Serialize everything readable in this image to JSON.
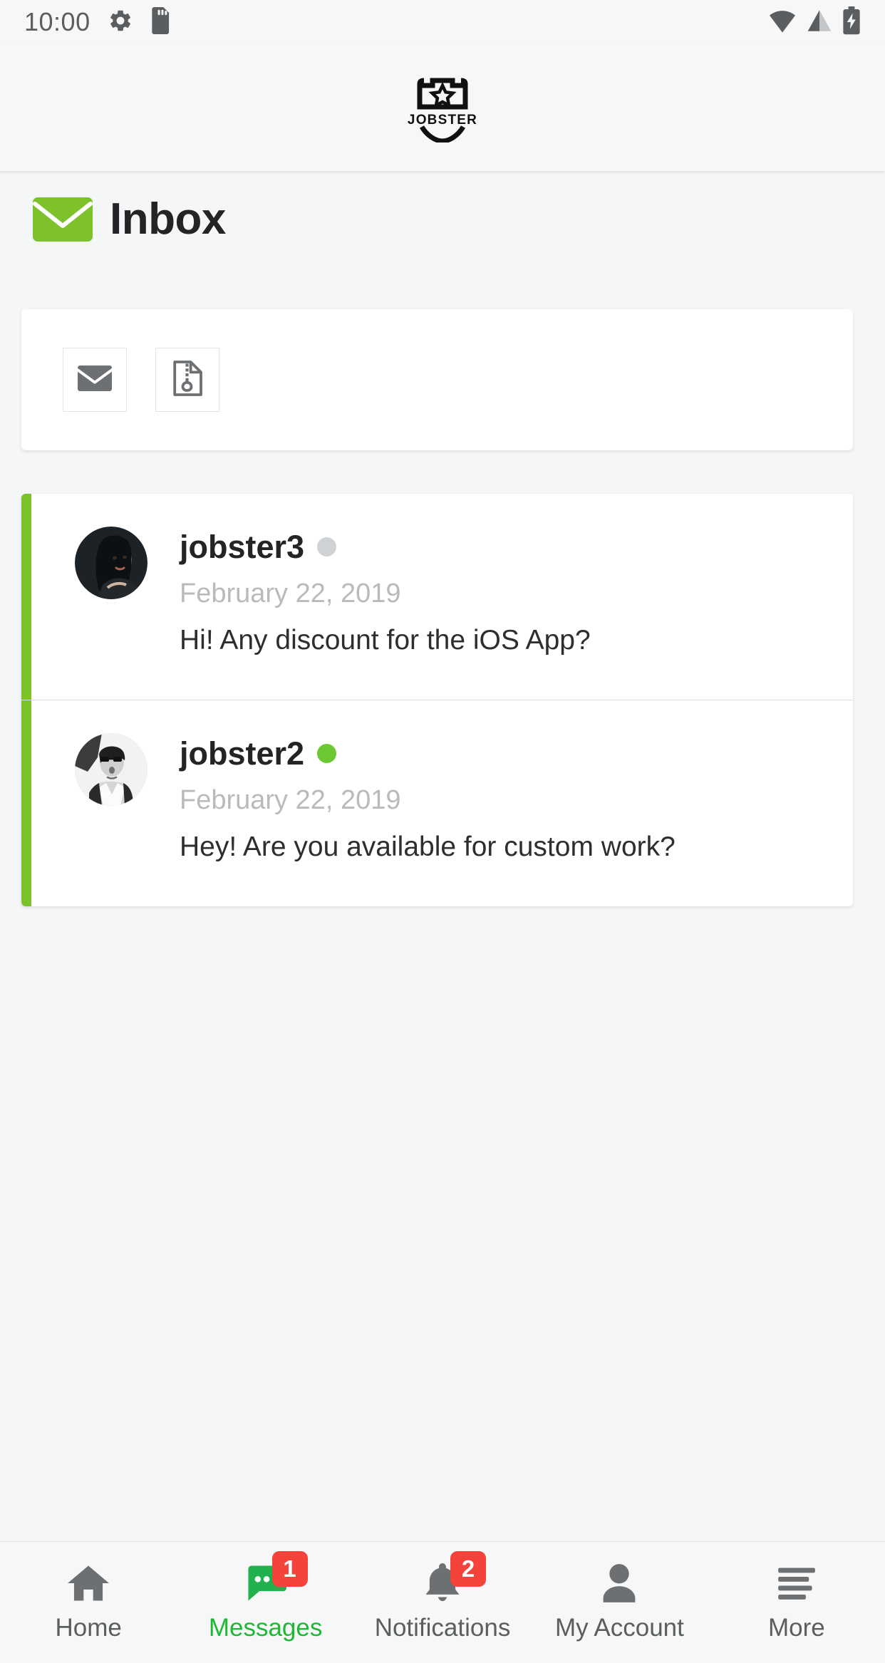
{
  "status_bar": {
    "time": "10:00",
    "left_icons": [
      "gear-icon",
      "sd-card-icon"
    ],
    "right_icons": [
      "wifi-icon",
      "cellular-signal-icon",
      "battery-charging-icon"
    ]
  },
  "app_header": {
    "logo_text": "JOBSTER",
    "logo_icon": "shield-star-icon"
  },
  "page": {
    "title": "Inbox",
    "title_icon": "envelope-icon",
    "accent_color": "#7DC22B"
  },
  "toolbar": {
    "buttons": [
      {
        "name": "compose-message-button",
        "icon": "envelope-icon"
      },
      {
        "name": "archive-attachment-button",
        "icon": "file-archive-icon"
      }
    ]
  },
  "messages": [
    {
      "username": "jobster3",
      "status": "offline",
      "status_color": "#cfd2d4",
      "date": "February 22, 2019",
      "preview": "Hi! Any discount for the iOS App?"
    },
    {
      "username": "jobster2",
      "status": "online",
      "status_color": "#6cc832",
      "date": "February 22, 2019",
      "preview": "Hey! Are you available for custom work?"
    }
  ],
  "bottom_nav": {
    "active_color": "#1db935",
    "badge_color": "#f4433a",
    "items": [
      {
        "label": "Home",
        "icon": "home-icon",
        "badge": "",
        "active": false
      },
      {
        "label": "Messages",
        "icon": "chat-bubble-icon",
        "badge": "1",
        "active": true
      },
      {
        "label": "Notifications",
        "icon": "bell-icon",
        "badge": "2",
        "active": false
      },
      {
        "label": "My Account",
        "icon": "person-icon",
        "badge": "",
        "active": false
      },
      {
        "label": "More",
        "icon": "hamburger-menu-icon",
        "badge": "",
        "active": false
      }
    ]
  }
}
